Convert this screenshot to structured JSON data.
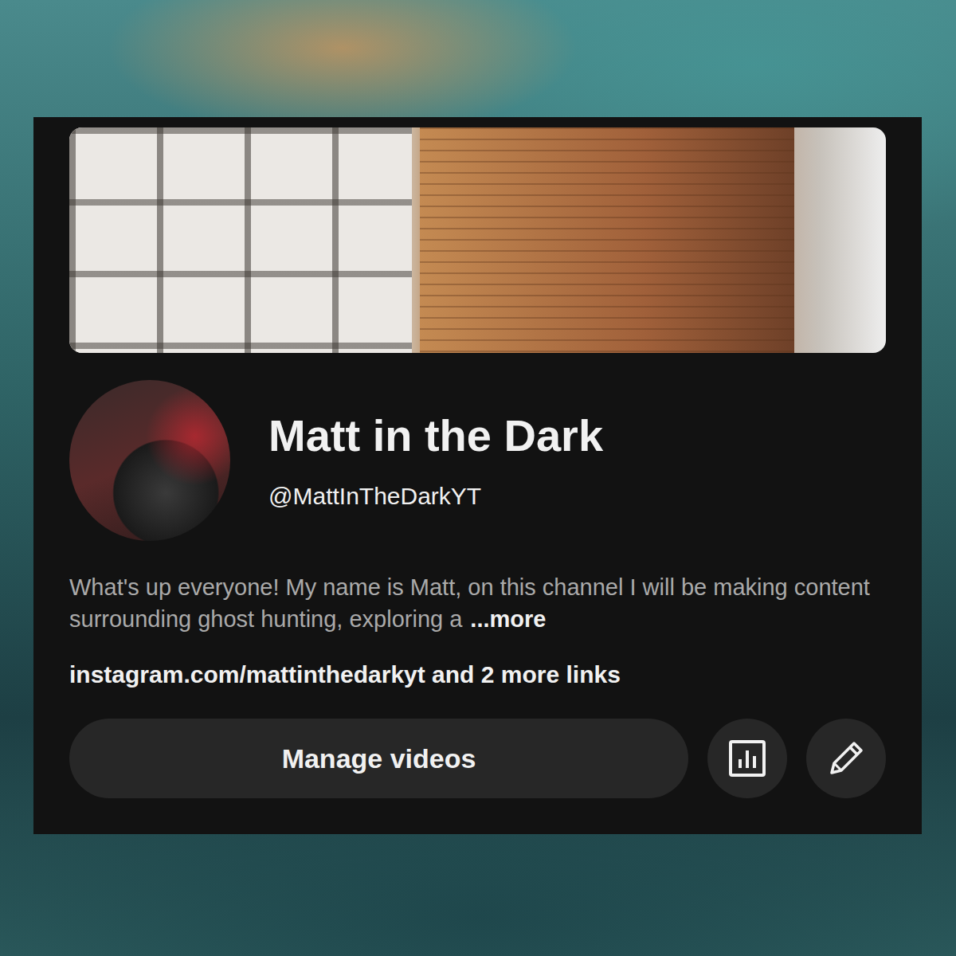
{
  "channel": {
    "name": "Matt in the Dark",
    "handle": "@MattInTheDarkYT"
  },
  "description": {
    "text": "What's up everyone! My name is Matt, on this channel I will be making content surrounding ghost hunting, exploring a",
    "more": "...more"
  },
  "links": {
    "text": "instagram.com/mattinthedarkyt and 2 more links"
  },
  "buttons": {
    "primary": "Manage videos"
  }
}
